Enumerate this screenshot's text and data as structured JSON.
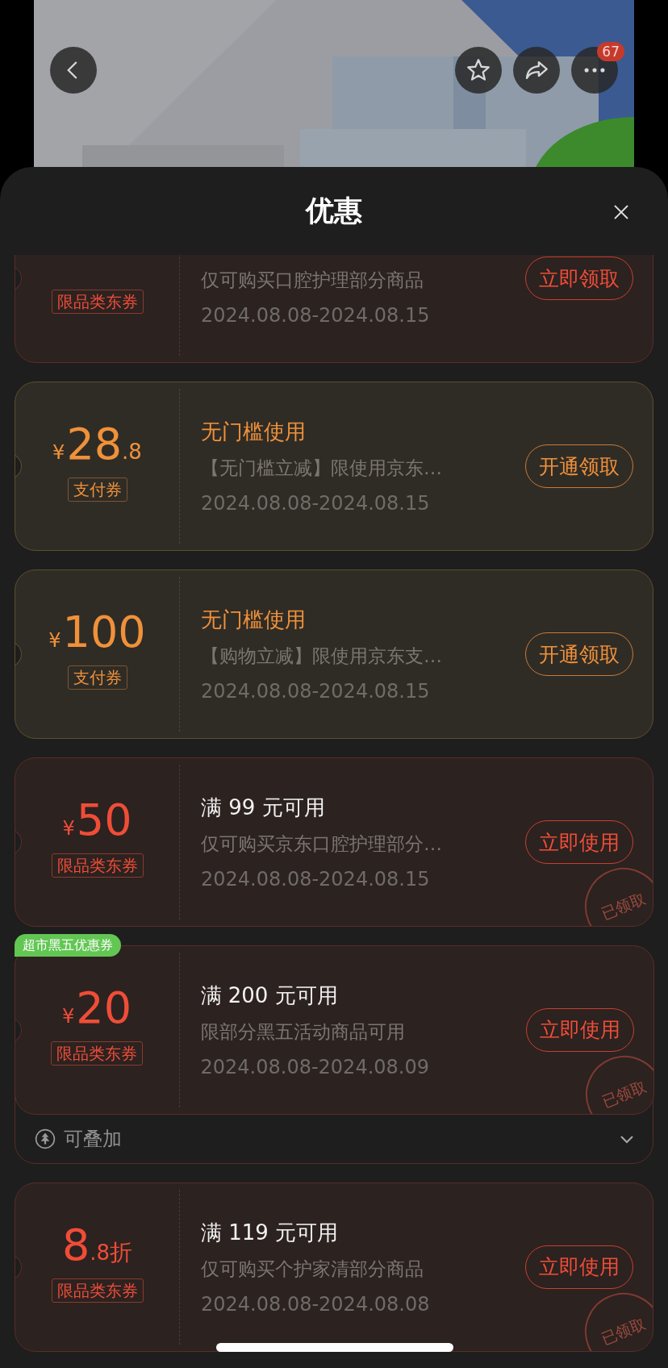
{
  "top_bar": {
    "badge": "67"
  },
  "sheet": {
    "title": "优惠"
  },
  "coupons": [
    {
      "kind": "red",
      "tag": "限品类东券",
      "description": "仅可购买口腔护理部分商品",
      "date": "2024.08.08-2024.08.15",
      "button": "立即领取"
    },
    {
      "kind": "gold",
      "amount": {
        "currency": "¥",
        "value": "28",
        "fraction": ".8"
      },
      "tag": "支付券",
      "title": "无门槛使用",
      "description": "【无门槛立减】限使用京东…",
      "date": "2024.08.08-2024.08.15",
      "button": "开通领取"
    },
    {
      "kind": "gold",
      "amount": {
        "currency": "¥",
        "value": "100"
      },
      "tag": "支付券",
      "title": "无门槛使用",
      "description": "【购物立减】限使用京东支…",
      "date": "2024.08.08-2024.08.15",
      "button": "开通领取"
    },
    {
      "kind": "red",
      "amount": {
        "currency": "¥",
        "value": "50"
      },
      "tag": "限品类东券",
      "title": "满 99 元可用",
      "description": "仅可购买京东口腔护理部分…",
      "date": "2024.08.08-2024.08.15",
      "button": "立即使用",
      "stamp": "已领取"
    },
    {
      "kind": "red",
      "badge": "超市黑五优惠券",
      "amount": {
        "currency": "¥",
        "value": "20"
      },
      "tag": "限品类东券",
      "title": "满 200 元可用",
      "description": "限部分黑五活动商品可用",
      "date": "2024.08.08-2024.08.09",
      "button": "立即使用",
      "stamp": "已领取",
      "stack": {
        "label": "可叠加",
        "expanded": false
      }
    },
    {
      "kind": "red",
      "amount": {
        "value": "8",
        "fraction": ".8",
        "unit": "折"
      },
      "tag": "限品类东券",
      "title": "满 119 元可用",
      "description": "仅可购买个护家清部分商品",
      "date": "2024.08.08-2024.08.08",
      "button": "立即使用",
      "stamp": "已领取"
    }
  ]
}
